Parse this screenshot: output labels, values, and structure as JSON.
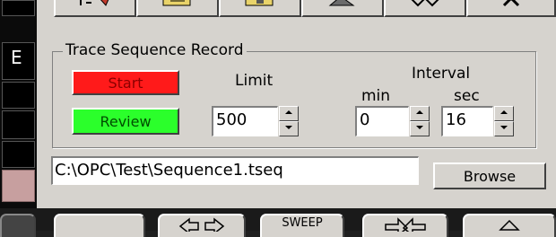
{
  "left_strip": {
    "letter": "E"
  },
  "group": {
    "title": "Trace Sequence Record"
  },
  "buttons": {
    "start": "Start",
    "review": "Review",
    "browse": "Browse"
  },
  "limit": {
    "label": "Limit",
    "value": "500"
  },
  "interval": {
    "label": "Interval",
    "min_label": "min",
    "sec_label": "sec",
    "min_value": "0",
    "sec_value": "16"
  },
  "file_path": "C:\\OPC\\Test\\Sequence1.tseq",
  "bottom_buttons": {
    "sweep": "SWEEP"
  },
  "colors": {
    "start_bg": "#ff1a1a",
    "review_bg": "#2bff2b",
    "panel": "#d6d3ce"
  }
}
